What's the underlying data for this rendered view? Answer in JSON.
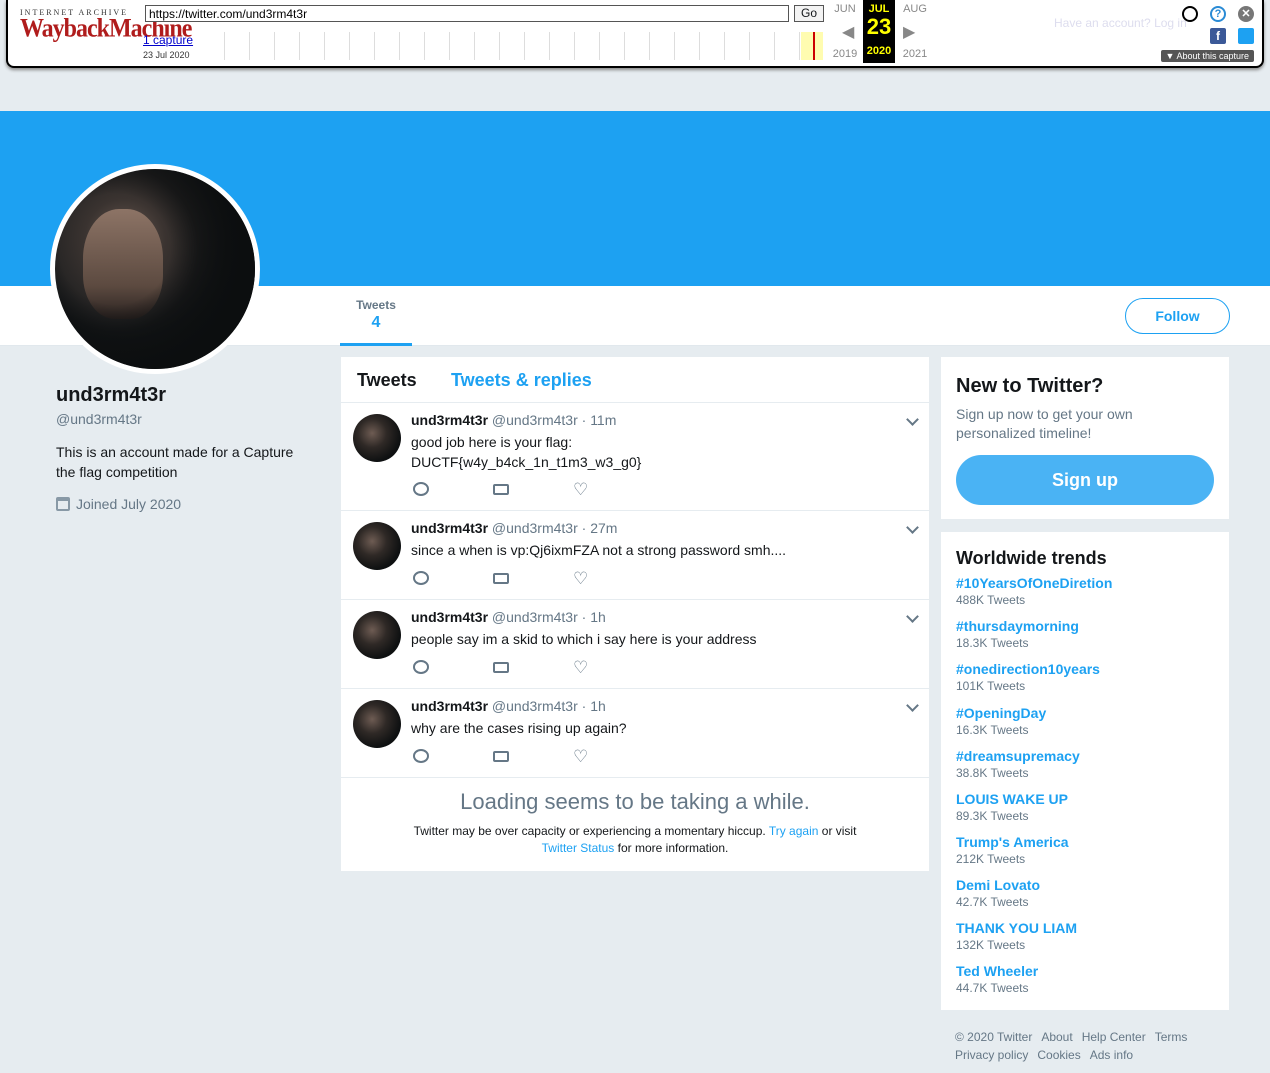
{
  "wayback": {
    "logo_top": "INTERNET ARCHIVE",
    "logo_main": "WaybackMachine",
    "url": "https://twitter.com/und3rm4t3r",
    "go_label": "Go",
    "captures_link": "1 capture",
    "capture_date": "23 Jul 2020",
    "prev_month": "JUN",
    "cur_month": "JUL",
    "next_month": "AUG",
    "cur_day": "23",
    "prev_year": "2019",
    "cur_year": "2020",
    "next_year": "2021",
    "about_label": "About this capture",
    "hidden_text": "Have an account? Log in"
  },
  "profile": {
    "name": "und3rm4t3r",
    "handle": "@und3rm4t3r",
    "bio": "This is an account made for a Capture the flag competition",
    "joined": "Joined July 2020"
  },
  "nav": {
    "tweets_label": "Tweets",
    "tweets_count": "4",
    "follow_label": "Follow"
  },
  "timeline": {
    "tab_tweets": "Tweets",
    "tab_replies": "Tweets & replies",
    "tweets": [
      {
        "name": "und3rm4t3r",
        "handle": "@und3rm4t3r",
        "time": "11m",
        "text": "good job here is your flag:",
        "text2": "DUCTF{w4y_b4ck_1n_t1m3_w3_g0}"
      },
      {
        "name": "und3rm4t3r",
        "handle": "@und3rm4t3r",
        "time": "27m",
        "text": "since a when is vp:Qj6ixmFZA not a strong password smh...."
      },
      {
        "name": "und3rm4t3r",
        "handle": "@und3rm4t3r",
        "time": "1h",
        "text": "people say im a skid to which i say here is your address"
      },
      {
        "name": "und3rm4t3r",
        "handle": "@und3rm4t3r",
        "time": "1h",
        "text": "why are the cases rising up again?"
      }
    ],
    "loading_title": "Loading seems to be taking a while.",
    "loading_text_1": "Twitter may be over capacity or experiencing a momentary hiccup.",
    "loading_try": "Try again",
    "loading_text_2": "or visit",
    "loading_status": "Twitter Status",
    "loading_text_3": "for more information."
  },
  "signup": {
    "title": "New to Twitter?",
    "text": "Sign up now to get your own personalized timeline!",
    "button": "Sign up"
  },
  "trends": {
    "title": "Worldwide trends",
    "items": [
      {
        "tag": "#10YearsOfOneDiretion",
        "count": "488K Tweets"
      },
      {
        "tag": "#thursdaymorning",
        "count": "18.3K Tweets"
      },
      {
        "tag": "#onedirection10years",
        "count": "101K Tweets"
      },
      {
        "tag": "#OpeningDay",
        "count": "16.3K Tweets"
      },
      {
        "tag": "#dreamsupremacy",
        "count": "38.8K Tweets"
      },
      {
        "tag": "LOUIS WAKE UP",
        "count": "89.3K Tweets"
      },
      {
        "tag": "Trump's America",
        "count": "212K Tweets"
      },
      {
        "tag": "Demi Lovato",
        "count": "42.7K Tweets"
      },
      {
        "tag": "THANK YOU LIAM",
        "count": "132K Tweets"
      },
      {
        "tag": "Ted Wheeler",
        "count": "44.7K Tweets"
      }
    ]
  },
  "footer": {
    "copyright": "© 2020 Twitter",
    "about": "About",
    "help": "Help Center",
    "terms": "Terms",
    "privacy": "Privacy policy",
    "cookies": "Cookies",
    "ads": "Ads info"
  },
  "colors": {
    "accent": "#1da1f2",
    "page_bg": "#e6ecf0",
    "wayback_red": "#b01c1c"
  }
}
